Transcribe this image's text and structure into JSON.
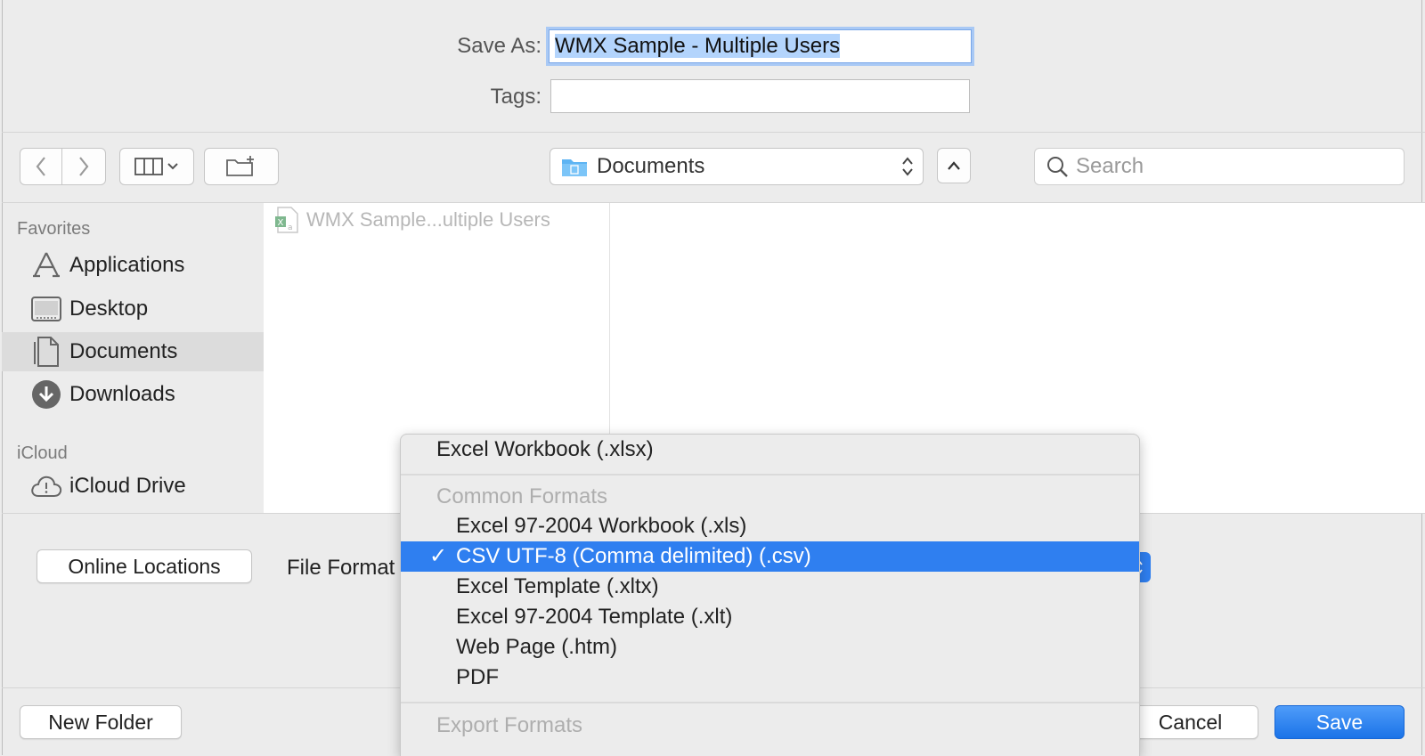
{
  "dialog": {
    "save_as_label": "Save As:",
    "save_as_value": "WMX Sample - Multiple Users",
    "tags_label": "Tags:",
    "tags_value": ""
  },
  "toolbar": {
    "location": "Documents",
    "search_placeholder": "Search"
  },
  "sidebar": {
    "sections": [
      {
        "title": "Favorites",
        "items": [
          "Applications",
          "Desktop",
          "Documents",
          "Downloads"
        ]
      },
      {
        "title": "iCloud",
        "items": [
          "iCloud Drive"
        ]
      }
    ],
    "selected": "Documents"
  },
  "browser": {
    "files": [
      {
        "name": "WMX Sample...ultiple Users",
        "icon": "excel-file-icon"
      }
    ]
  },
  "options": {
    "online_locations_label": "Online Locations",
    "file_format_label": "File Format"
  },
  "footer": {
    "new_folder_label": "New Folder",
    "cancel_label": "Cancel",
    "save_label": "Save"
  },
  "format_menu": {
    "top_item": "Excel Workbook (.xlsx)",
    "common_header": "Common Formats",
    "common_items": [
      "Excel 97-2004 Workbook (.xls)",
      "CSV UTF-8 (Comma delimited) (.csv)",
      "Excel Template (.xltx)",
      "Excel 97-2004 Template (.xlt)",
      "Web Page (.htm)",
      "PDF"
    ],
    "selected_index": 1,
    "check_mark": "✓",
    "export_header": "Export Formats"
  },
  "colors": {
    "accent": "#2f7ff0",
    "focus_ring": "#a9c9f5",
    "selection": "#b3d4fc"
  }
}
